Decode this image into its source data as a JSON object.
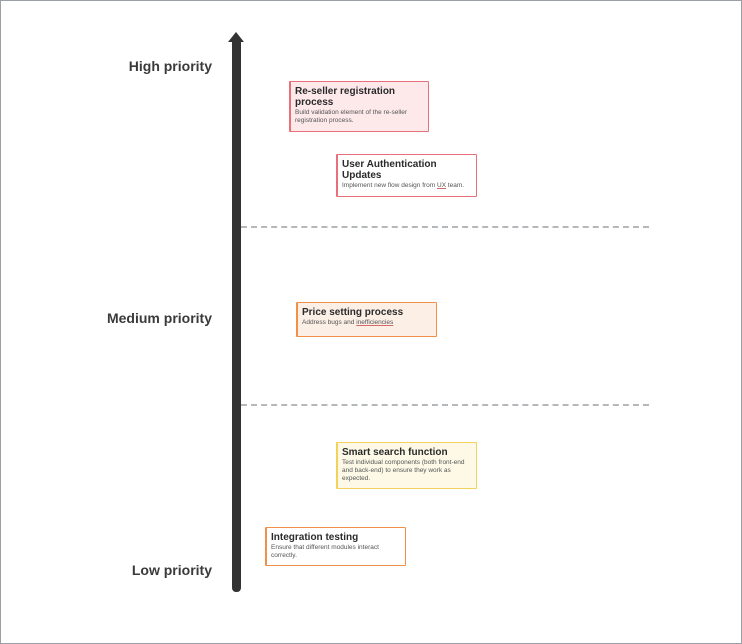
{
  "axis": {
    "labels": {
      "high": "High priority",
      "medium": "Medium priority",
      "low": "Low priority"
    },
    "color": "#333333"
  },
  "cards": [
    {
      "title": "Re-seller registration process",
      "description": "Build validation element of the re-seller registration process.",
      "priority": "high",
      "border_color": "#e8707a",
      "background": "#fde8ea"
    },
    {
      "title": "User Authentication Updates",
      "description_before": "Implement new flow design from ",
      "description_underlined": "UX",
      "description_after": " team.",
      "priority": "high",
      "border_color": "#e8707a",
      "background": "#ffffff"
    },
    {
      "title": "Price setting process",
      "description_before": "Address bugs and ",
      "description_underlined": "inefficiencies",
      "priority": "medium",
      "border_color": "#f0904a",
      "background": "#fcefe6"
    },
    {
      "title": "Smart search function",
      "description": "Test individual components (both front-end and back-end) to ensure they work as expected.",
      "priority": "low",
      "border_color": "#f2d25a",
      "background": "#fdf9e6"
    },
    {
      "title": "Integration testing",
      "description": "Ensure that different modules interact correctly.",
      "priority": "low",
      "border_color": "#f0904a",
      "background": "#ffffff"
    }
  ]
}
